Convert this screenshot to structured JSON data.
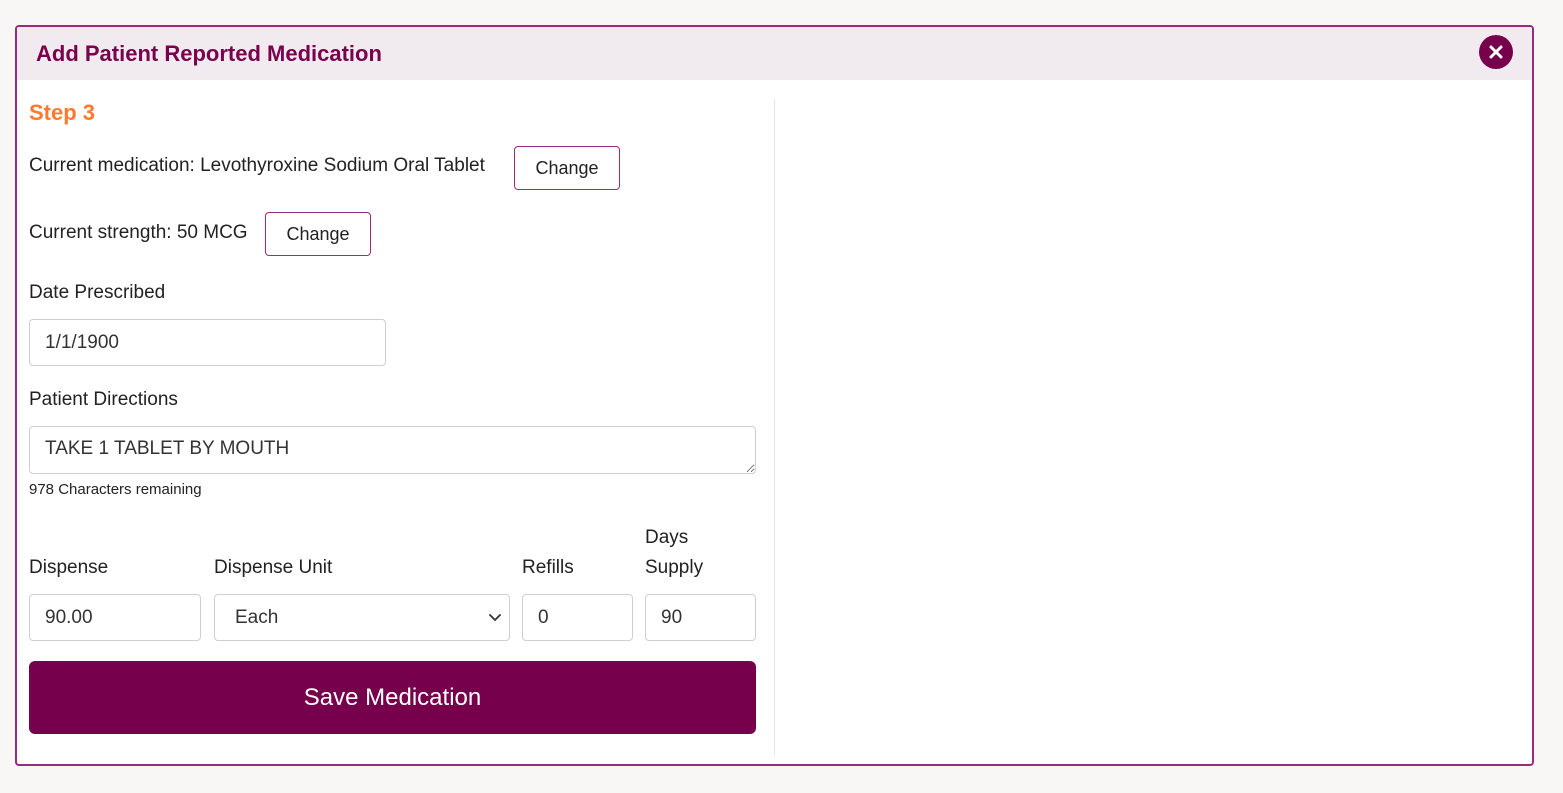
{
  "dialog": {
    "title": "Add Patient Reported Medication",
    "close_icon": "close-circle-icon"
  },
  "step": {
    "label": "Step 3"
  },
  "current_medication": {
    "label": "Current medication: Levothyroxine Sodium Oral Tablet",
    "change_label": "Change"
  },
  "current_strength": {
    "label": "Current strength: 50 MCG",
    "change_label": "Change"
  },
  "date_prescribed": {
    "label": "Date Prescribed",
    "value": "1/1/1900"
  },
  "patient_directions": {
    "label": "Patient Directions",
    "value": "TAKE 1 TABLET BY MOUTH",
    "chars_remaining": "978 Characters remaining"
  },
  "dispense": {
    "label": "Dispense",
    "value": "90.00"
  },
  "dispense_unit": {
    "label": "Dispense Unit",
    "value": "Each",
    "icon": "chevron-down-icon"
  },
  "refills": {
    "label": "Refills",
    "value": "0"
  },
  "days_supply": {
    "label_line1": "Days",
    "label_line2": "Supply",
    "value": "90"
  },
  "save_button": {
    "label": "Save Medication"
  },
  "colors": {
    "brand": "#77004c",
    "accent": "#ff7a2f",
    "header_bg": "#f1ebf0",
    "border": "#9b2a7f"
  }
}
